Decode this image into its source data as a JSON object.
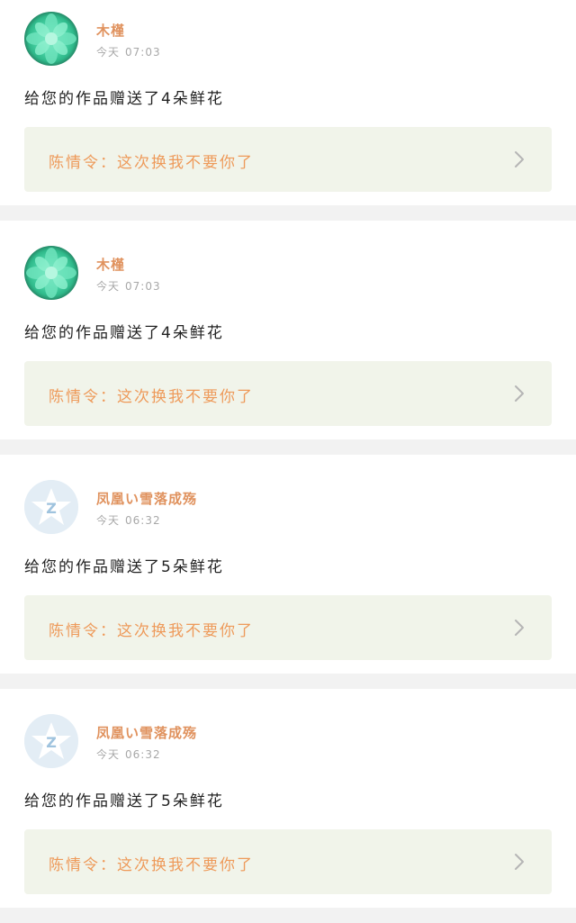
{
  "notifications": [
    {
      "avatar": "succulent-avatar",
      "username": "木槿",
      "day": "今天",
      "time": "07:03",
      "message": "给您的作品赠送了4朵鲜花",
      "work_label": "陈情令",
      "work_title": "这次换我不要你了"
    },
    {
      "avatar": "succulent-avatar",
      "username": "木槿",
      "day": "今天",
      "time": "07:03",
      "message": "给您的作品赠送了4朵鲜花",
      "work_label": "陈情令",
      "work_title": "这次换我不要你了"
    },
    {
      "avatar": "qq-default-avatar",
      "username": "凤凰い雪落成殇",
      "day": "今天",
      "time": "06:32",
      "message": "给您的作品赠送了5朵鲜花",
      "work_label": "陈情令",
      "work_title": "这次换我不要你了"
    },
    {
      "avatar": "qq-default-avatar",
      "username": "凤凰い雪落成殇",
      "day": "今天",
      "time": "06:32",
      "message": "给您的作品赠送了5朵鲜花",
      "work_label": "陈情令",
      "work_title": "这次换我不要你了"
    }
  ],
  "separator": "：",
  "colors": {
    "username": "#e0925e",
    "work_title": "#ee9a5a",
    "work_bg": "#f1f4ea",
    "page_bg": "#f2f2f2"
  }
}
